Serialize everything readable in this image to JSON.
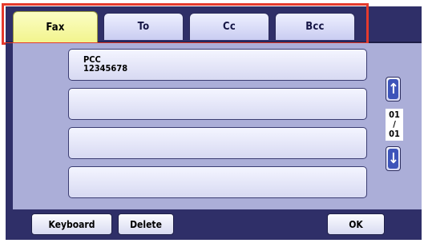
{
  "tabs": [
    "Fax",
    "To",
    "Cc",
    "Bcc"
  ],
  "destinations": [
    {
      "line1": "PCC",
      "line2": "12345678"
    },
    {
      "line1": "",
      "line2": ""
    },
    {
      "line1": "",
      "line2": ""
    },
    {
      "line1": "",
      "line2": ""
    }
  ],
  "pager": {
    "current": "01",
    "separator": "/",
    "total": "01"
  },
  "buttons": {
    "keyboard": "Keyboard",
    "delete": "Delete",
    "ok": "OK"
  },
  "colors": {
    "active_tab": "#f2f48c",
    "highlight_box": "#e53a2d",
    "frame": "#2f2f68",
    "panel": "#abaed8"
  }
}
